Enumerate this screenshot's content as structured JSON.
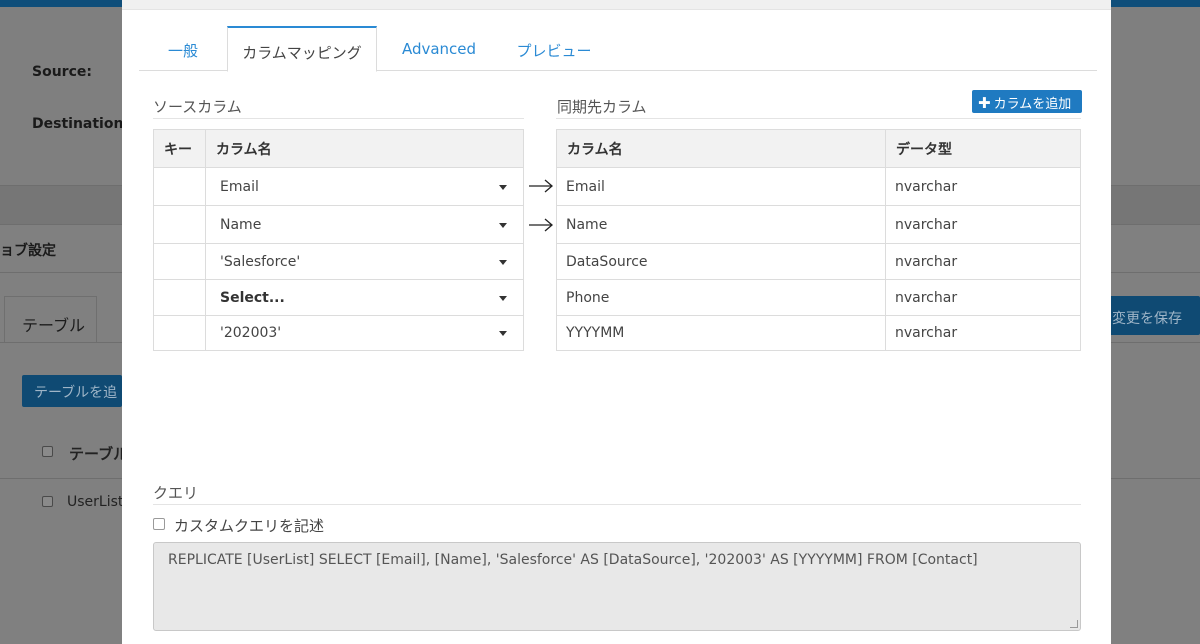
{
  "background": {
    "source_label": "Source:",
    "destination_label": "Destination:",
    "job_settings_title": "ョブ設定",
    "tab_table": "テーブル",
    "save_button": "変更を保存",
    "add_table_button": "テーブルを追",
    "table_header_label": "テーブル",
    "row_userlist": "UserList"
  },
  "modal": {
    "tabs": [
      {
        "label": "一般"
      },
      {
        "label": "カラムマッピング"
      },
      {
        "label": "Advanced"
      },
      {
        "label": "プレビュー"
      }
    ],
    "source_section_title": "ソースカラム",
    "dest_section_title": "同期先カラム",
    "add_column_button": "カラムを追加",
    "source_table": {
      "headers": [
        "キー",
        "カラム名"
      ],
      "rows": [
        {
          "key": "",
          "column": "Email"
        },
        {
          "key": "",
          "column": "Name"
        },
        {
          "key": "",
          "column": "'Salesforce'"
        },
        {
          "key": "",
          "column": "Select..."
        },
        {
          "key": "",
          "column": "'202003'"
        }
      ]
    },
    "dest_table": {
      "headers": [
        "カラム名",
        "データ型"
      ],
      "rows": [
        {
          "column": "Email",
          "type": "nvarchar"
        },
        {
          "column": "Name",
          "type": "nvarchar"
        },
        {
          "column": "DataSource",
          "type": "nvarchar"
        },
        {
          "column": "Phone",
          "type": "nvarchar"
        },
        {
          "column": "YYYYMM",
          "type": "nvarchar"
        }
      ]
    },
    "query_section_title": "クエリ",
    "custom_query_checkbox_label": "カスタムクエリを記述",
    "query_text": "REPLICATE [UserList] SELECT [Email], [Name], 'Salesforce' AS [DataSource], '202003' AS [YYYYMM] FROM [Contact]"
  },
  "colors": {
    "accent": "#2a8ad4",
    "button": "#1f7ac1"
  }
}
